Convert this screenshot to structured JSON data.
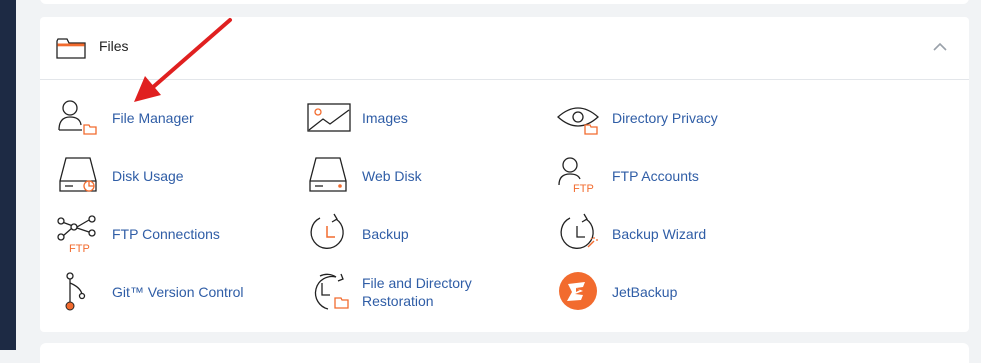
{
  "panel": {
    "title": "Files",
    "tools": [
      {
        "id": "file-manager",
        "label": "File Manager",
        "icon": "file-manager-icon"
      },
      {
        "id": "images",
        "label": "Images",
        "icon": "images-icon"
      },
      {
        "id": "directory-privacy",
        "label": "Directory Privacy",
        "icon": "directory-privacy-icon"
      },
      {
        "id": "disk-usage",
        "label": "Disk Usage",
        "icon": "disk-usage-icon"
      },
      {
        "id": "web-disk",
        "label": "Web Disk",
        "icon": "web-disk-icon"
      },
      {
        "id": "ftp-accounts",
        "label": "FTP Accounts",
        "icon": "ftp-accounts-icon"
      },
      {
        "id": "ftp-connections",
        "label": "FTP Connections",
        "icon": "ftp-connections-icon"
      },
      {
        "id": "backup",
        "label": "Backup",
        "icon": "backup-icon"
      },
      {
        "id": "backup-wizard",
        "label": "Backup Wizard",
        "icon": "backup-wizard-icon"
      },
      {
        "id": "git-version-control",
        "label": "Git™ Version Control",
        "icon": "git-icon"
      },
      {
        "id": "file-directory-restoration",
        "label_line1": "File and Directory",
        "label_line2": "Restoration",
        "icon": "restoration-icon"
      },
      {
        "id": "jetbackup",
        "label": "JetBackup",
        "icon": "jetbackup-logo-icon"
      }
    ]
  },
  "icon_labels": {
    "ftp": "FTP"
  },
  "colors": {
    "accent_orange": "#f26b2e",
    "link_blue": "#2f5da6",
    "annotation_red": "#e02020",
    "sidebar_navy": "#1d2a44"
  }
}
